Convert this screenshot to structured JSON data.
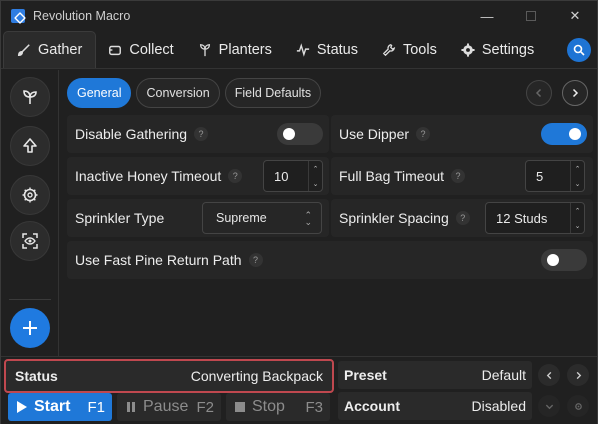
{
  "window": {
    "title": "Revolution Macro",
    "minimize": "—",
    "close": "✕"
  },
  "nav": {
    "tabs": [
      {
        "label": "Gather",
        "icon": "brush-icon",
        "active": true
      },
      {
        "label": "Collect",
        "icon": "ticket-icon"
      },
      {
        "label": "Planters",
        "icon": "sprout-icon"
      },
      {
        "label": "Status",
        "icon": "pulse-icon"
      },
      {
        "label": "Tools",
        "icon": "wrench-icon"
      },
      {
        "label": "Settings",
        "icon": "gear-icon"
      }
    ],
    "search_icon": "search-icon",
    "accent": "#1f78d8"
  },
  "sidebar": {
    "items": [
      {
        "icon": "sprout-icon"
      },
      {
        "icon": "arrow-up-icon"
      },
      {
        "icon": "gear-icon"
      },
      {
        "icon": "eye-scan-icon"
      }
    ],
    "add": {
      "icon": "plus-icon"
    }
  },
  "subtabs": [
    "General",
    "Conversion",
    "Field Defaults"
  ],
  "rows": {
    "disable_gathering": {
      "label": "Disable Gathering",
      "help": "?",
      "toggle": false
    },
    "use_dipper": {
      "label": "Use Dipper",
      "help": "?",
      "toggle": true
    },
    "inactive_honey": {
      "label": "Inactive Honey Timeout",
      "help": "?",
      "value": "10"
    },
    "full_bag": {
      "label": "Full Bag Timeout",
      "help": "?",
      "value": "5"
    },
    "sprinkler_type": {
      "label": "Sprinkler Type",
      "help": "",
      "value": "Supreme"
    },
    "sprinkler_spacing": {
      "label": "Sprinkler Spacing",
      "help": "?",
      "value": "12 Studs"
    },
    "fast_pine": {
      "label": "Use Fast Pine Return Path",
      "help": "?",
      "toggle": false
    }
  },
  "bottom": {
    "status": {
      "label": "Status",
      "value": "Converting Backpack"
    },
    "preset": {
      "label": "Preset",
      "value": "Default"
    },
    "account": {
      "label": "Account",
      "value": "Disabled"
    },
    "start": {
      "label": "Start",
      "key": "F1"
    },
    "pause": {
      "label": "Pause",
      "key": "F2"
    },
    "stop": {
      "label": "Stop",
      "key": "F3"
    },
    "status_border_color": "#c0484f"
  }
}
